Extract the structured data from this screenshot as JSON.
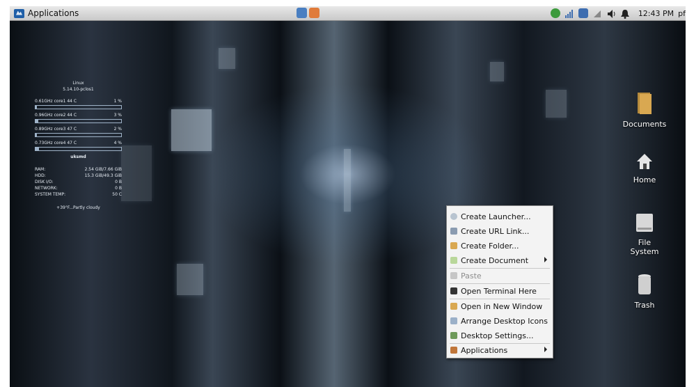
{
  "panel": {
    "apps_label": "Applications",
    "clock": "12:43 PM",
    "user": "pf"
  },
  "conky": {
    "os": "Linux",
    "kernel": "5.14.10-pclos1",
    "cores": [
      {
        "freq": "0.61GHz",
        "name": "core1",
        "temp": "44 C",
        "pct": "1 %",
        "level": 0.01
      },
      {
        "freq": "0.96GHz",
        "name": "core2",
        "temp": "44 C",
        "pct": "3 %",
        "level": 0.03
      },
      {
        "freq": "0.89GHz",
        "name": "core3",
        "temp": "47 C",
        "pct": "2 %",
        "level": 0.02
      },
      {
        "freq": "0.73GHz",
        "name": "core4",
        "temp": "47 C",
        "pct": "4 %",
        "level": 0.04
      }
    ],
    "process": "uksmd",
    "stats": [
      {
        "label": "RAM:",
        "value": "2.54 GiB/7.66 GiB"
      },
      {
        "label": "HDD:",
        "value": "15.3 GiB/49.3 GiB"
      },
      {
        "label": "DISK I/O:",
        "value": "0 B"
      },
      {
        "label": "NETWORK:",
        "value": "0 B"
      },
      {
        "label": "SYSTEM TEMP:",
        "value": "50 C"
      }
    ],
    "weather": "+39°F...Partly cloudy"
  },
  "desktop_icons": {
    "documents": "Documents",
    "home": "Home",
    "file_system_1": "File",
    "file_system_2": "System",
    "trash": "Trash"
  },
  "context_menu": {
    "create_launcher": "Create Launcher...",
    "create_url_link": "Create URL Link...",
    "create_folder": "Create Folder...",
    "create_document": "Create Document",
    "paste": "Paste",
    "open_terminal": "Open Terminal Here",
    "open_new_window": "Open in New Window",
    "arrange_icons": "Arrange Desktop Icons",
    "desktop_settings": "Desktop Settings...",
    "applications": "Applications"
  },
  "colors": {
    "panel_bg": "#d6d6d6",
    "menu_bg": "#f3f3f3",
    "conky_text": "#e8eef5"
  }
}
